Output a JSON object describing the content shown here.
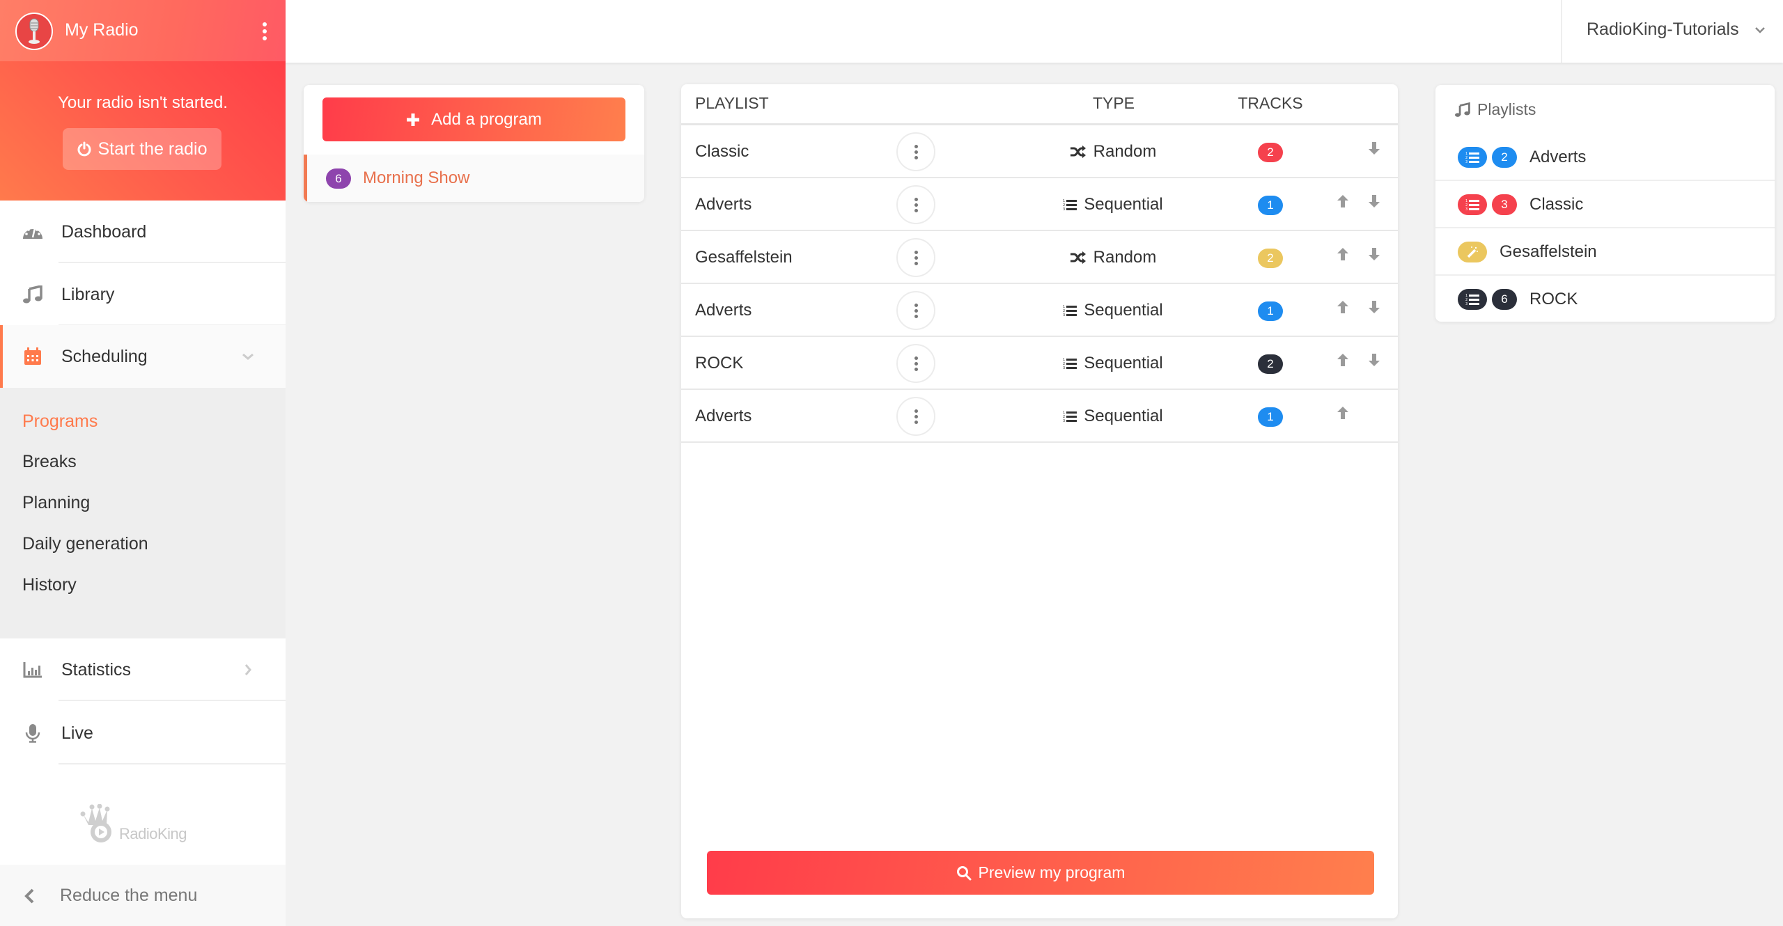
{
  "sidebar": {
    "brand": "My Radio",
    "status_text": "Your radio isn't started.",
    "start_label": "Start the radio",
    "nav": [
      {
        "label": "Dashboard",
        "icon": "dashboard-icon"
      },
      {
        "label": "Library",
        "icon": "music-icon"
      },
      {
        "label": "Scheduling",
        "icon": "calendar-icon"
      },
      {
        "label": "Statistics",
        "icon": "bar-chart-icon"
      },
      {
        "label": "Live",
        "icon": "microphone-icon"
      }
    ],
    "submenu": [
      "Programs",
      "Breaks",
      "Planning",
      "Daily generation",
      "History"
    ],
    "active_sub": "Programs",
    "logo_text": "RadioKing",
    "reduce_label": "Reduce the menu"
  },
  "topbar": {
    "account": "RadioKing-Tutorials"
  },
  "programs": {
    "add_label": "Add a program",
    "items": [
      {
        "count": "6",
        "name": "Morning Show",
        "color": "#8e44ad"
      }
    ]
  },
  "table": {
    "headers": {
      "playlist": "PLAYLIST",
      "type": "TYPE",
      "tracks": "TRACKS"
    },
    "rows": [
      {
        "name": "Classic",
        "type": "Random",
        "tracks": "2",
        "color": "#f5414d",
        "up": false,
        "down": true
      },
      {
        "name": "Adverts",
        "type": "Sequential",
        "tracks": "1",
        "color": "#1e8cf0",
        "up": true,
        "down": true
      },
      {
        "name": "Gesaffelstein",
        "type": "Random",
        "tracks": "2",
        "color": "#ebc75f",
        "up": true,
        "down": true
      },
      {
        "name": "Adverts",
        "type": "Sequential",
        "tracks": "1",
        "color": "#1e8cf0",
        "up": true,
        "down": true
      },
      {
        "name": "ROCK",
        "type": "Sequential",
        "tracks": "2",
        "color": "#2b2f3a",
        "up": true,
        "down": true
      },
      {
        "name": "Adverts",
        "type": "Sequential",
        "tracks": "1",
        "color": "#1e8cf0",
        "up": true,
        "down": false
      }
    ],
    "preview_label": "Preview my program"
  },
  "playlists": {
    "title": "Playlists",
    "items": [
      {
        "name": "Adverts",
        "kind": "sequential",
        "count": "2",
        "color": "#1e8cf0"
      },
      {
        "name": "Classic",
        "kind": "sequential",
        "count": "3",
        "color": "#f5414d"
      },
      {
        "name": "Gesaffelstein",
        "kind": "smart",
        "count": null,
        "color": "#ebc75f"
      },
      {
        "name": "ROCK",
        "kind": "sequential",
        "count": "6",
        "color": "#2b2f3a"
      }
    ]
  },
  "colors": {
    "accent": "#ff7a4c",
    "gradient_start": "#ff3c4a",
    "gradient_end": "#ff7f4d"
  }
}
